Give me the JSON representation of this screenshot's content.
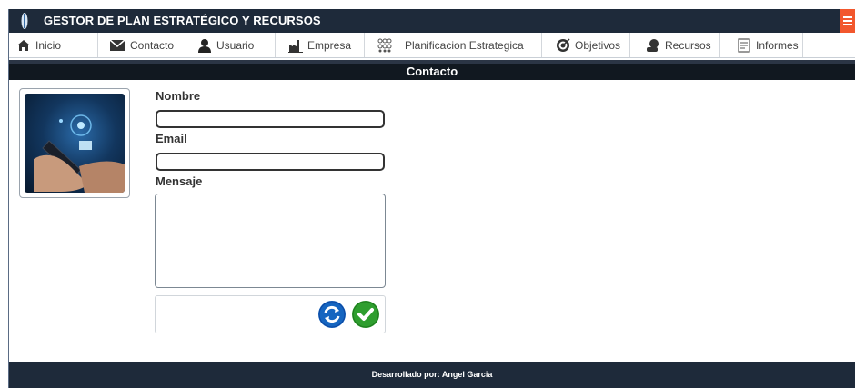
{
  "app": {
    "title": "GESTOR DE PLAN ESTRATÉGICO Y RECURSOS"
  },
  "nav": {
    "items": [
      {
        "label": "Inicio",
        "icon": "home-icon"
      },
      {
        "label": "Contacto",
        "icon": "envelope-icon"
      },
      {
        "label": "Usuario",
        "icon": "user-icon"
      },
      {
        "label": "Empresa",
        "icon": "factory-icon"
      },
      {
        "label": "Planificacion Estrategica",
        "icon": "strategy-icon"
      },
      {
        "label": "Objetivos",
        "icon": "target-icon"
      },
      {
        "label": "Recursos",
        "icon": "resources-icon"
      },
      {
        "label": "Informes",
        "icon": "report-icon"
      }
    ]
  },
  "section": {
    "title": "Contacto"
  },
  "form": {
    "name_label": "Nombre",
    "name_value": "",
    "email_label": "Email",
    "email_value": "",
    "message_label": "Mensaje",
    "message_value": "",
    "reset_icon": "refresh-icon",
    "submit_icon": "check-icon"
  },
  "footer": {
    "text": "Desarrollado por: Angel Garcia"
  },
  "colors": {
    "header": "#1e2a3a",
    "menu_accent": "#f2572d",
    "reset_blue": "#1565c0",
    "submit_green": "#2e9e2e"
  }
}
